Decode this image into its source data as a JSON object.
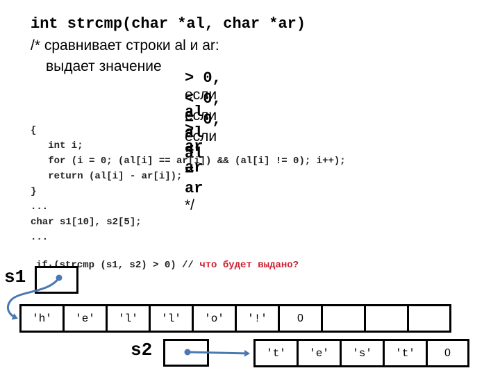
{
  "header": {
    "signature": "int strcmp(char *al, char *ar)",
    "comment_line1": "/* сравнивает строки al и ar:",
    "comment_prefix": "выдает значение",
    "conditions": [
      {
        "op": "> 0,",
        "word": "если",
        "lhs": "al",
        "cmp": ">",
        "rhs": "ar",
        "tail": ""
      },
      {
        "op": "< 0,",
        "word": "если",
        "lhs": "al",
        "cmp": "<",
        "rhs": "ar",
        "tail": ""
      },
      {
        "op": "= 0,",
        "word": "если",
        "lhs": "al",
        "cmp": "=",
        "rhs": "ar",
        "tail": "*/"
      }
    ]
  },
  "code": {
    "lines": [
      "{",
      "   int i;",
      "   for (i = 0; (al[i] == ar[i]) && (al[i] != 0); i++);",
      "   return (al[i] - ar[i]);",
      "}",
      "...",
      "char s1[10], s2[5];",
      "...",
      "if (strcmp (s1, s2) > 0) // "
    ],
    "question": "что будет выдано?",
    "trailing_dots": "..."
  },
  "diagram": {
    "s1": {
      "label": "s1",
      "cells": [
        "'h'",
        "'e'",
        "'l'",
        "'l'",
        "'o'",
        "'!'",
        "0",
        "",
        "",
        ""
      ]
    },
    "s2": {
      "label": "s2",
      "cells": [
        "'t'",
        "'e'",
        "'s'",
        "'t'",
        "0"
      ]
    },
    "colors": {
      "pointer": "#4a78b0",
      "question": "#cc1f2f"
    }
  }
}
